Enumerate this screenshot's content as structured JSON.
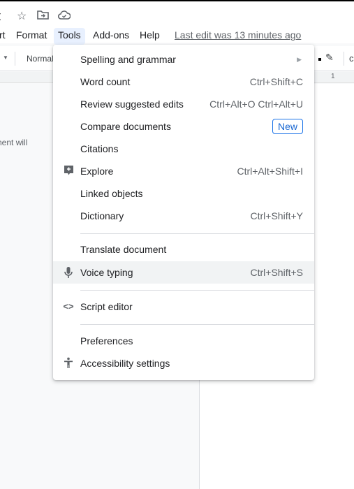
{
  "title": {
    "text": "t",
    "icons": [
      "star-icon",
      "move-to-folder-icon",
      "cloud-saved-icon"
    ]
  },
  "menubar": {
    "items": [
      "rt",
      "Format",
      "Tools",
      "Add-ons",
      "Help"
    ],
    "last_edit": "Last edit was 13 minutes ago"
  },
  "toolbar": {
    "style": "Normal",
    "ruler_mark": "1"
  },
  "doc": {
    "text": "nent will"
  },
  "tools_menu": {
    "items": [
      {
        "label": "Spelling and grammar",
        "submenu": true
      },
      {
        "label": "Word count",
        "shortcut": "Ctrl+Shift+C"
      },
      {
        "label": "Review suggested edits",
        "shortcut": "Ctrl+Alt+O Ctrl+Alt+U"
      },
      {
        "label": "Compare documents",
        "badge": "New"
      },
      {
        "label": "Citations"
      },
      {
        "label": "Explore",
        "shortcut": "Ctrl+Alt+Shift+I",
        "icon": "explore-icon"
      },
      {
        "label": "Linked objects"
      },
      {
        "label": "Dictionary",
        "shortcut": "Ctrl+Shift+Y"
      },
      {
        "label": "Translate document"
      },
      {
        "label": "Voice typing",
        "shortcut": "Ctrl+Shift+S",
        "icon": "microphone-icon",
        "hovered": true
      },
      {
        "label": "Script editor",
        "icon": "code-icon"
      },
      {
        "label": "Preferences"
      },
      {
        "label": "Accessibility settings",
        "icon": "accessibility-icon"
      }
    ]
  },
  "colors": {
    "accent": "#1a73e8",
    "hover": "#f1f3f4",
    "active_menu": "#e8f0fe"
  }
}
